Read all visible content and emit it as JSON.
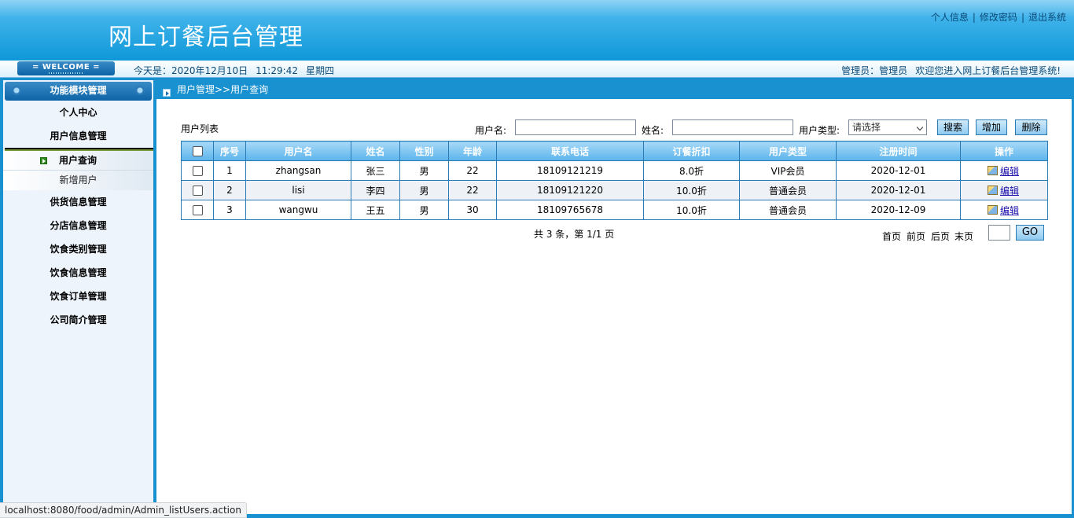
{
  "header": {
    "title": "网上订餐后台管理",
    "links": [
      "个人信息",
      "修改密码",
      "退出系统"
    ],
    "separator": "|"
  },
  "infobar": {
    "welcome": "= WELCOME =",
    "date_prefix": "今天是：2020年12月10日",
    "time": "11:29:42",
    "weekday": "星期四",
    "admin": "管理员：管理员",
    "greeting": "欢迎您进入网上订餐后台管理系统!"
  },
  "sidebar": {
    "title": "功能模块管理",
    "menus": [
      "个人中心",
      "用户信息管理"
    ],
    "submenu_active": "用户查询",
    "submenu_other": "新增用户",
    "menus_after": [
      "供货信息管理",
      "分店信息管理",
      "饮食类别管理",
      "饮食信息管理",
      "饮食订单管理",
      "公司简介管理"
    ]
  },
  "breadcrumb": "用户管理>>用户查询",
  "search": {
    "list_title": "用户列表",
    "username_label": "用户名:",
    "name_label": "姓名:",
    "type_label": "用户类型:",
    "type_value": "请选择",
    "search_button": "搜索",
    "add_button": "增加",
    "delete_button": "删除"
  },
  "table": {
    "headers": [
      "序号",
      "用户名",
      "姓名",
      "性别",
      "年龄",
      "联系电话",
      "订餐折扣",
      "用户类型",
      "注册时间",
      "操作"
    ],
    "edit_label": "编辑",
    "rows": [
      {
        "no": "1",
        "username": "zhangsan",
        "name": "张三",
        "gender": "男",
        "age": "22",
        "phone": "18109121219",
        "discount": "8.0折",
        "type": "VIP会员",
        "reg": "2020-12-01"
      },
      {
        "no": "2",
        "username": "lisi",
        "name": "李四",
        "gender": "男",
        "age": "22",
        "phone": "18109121220",
        "discount": "10.0折",
        "type": "普通会员",
        "reg": "2020-12-01"
      },
      {
        "no": "3",
        "username": "wangwu",
        "name": "王五",
        "gender": "男",
        "age": "30",
        "phone": "18109765678",
        "discount": "10.0折",
        "type": "普通会员",
        "reg": "2020-12-09"
      }
    ]
  },
  "pagination": {
    "summary": "共 3 条，第 1/1 页",
    "first": "首页",
    "prev": "前页",
    "next": "后页",
    "last": "末页",
    "go": "GO"
  },
  "status_url": "localhost:8080/food/admin/Admin_listUsers.action"
}
